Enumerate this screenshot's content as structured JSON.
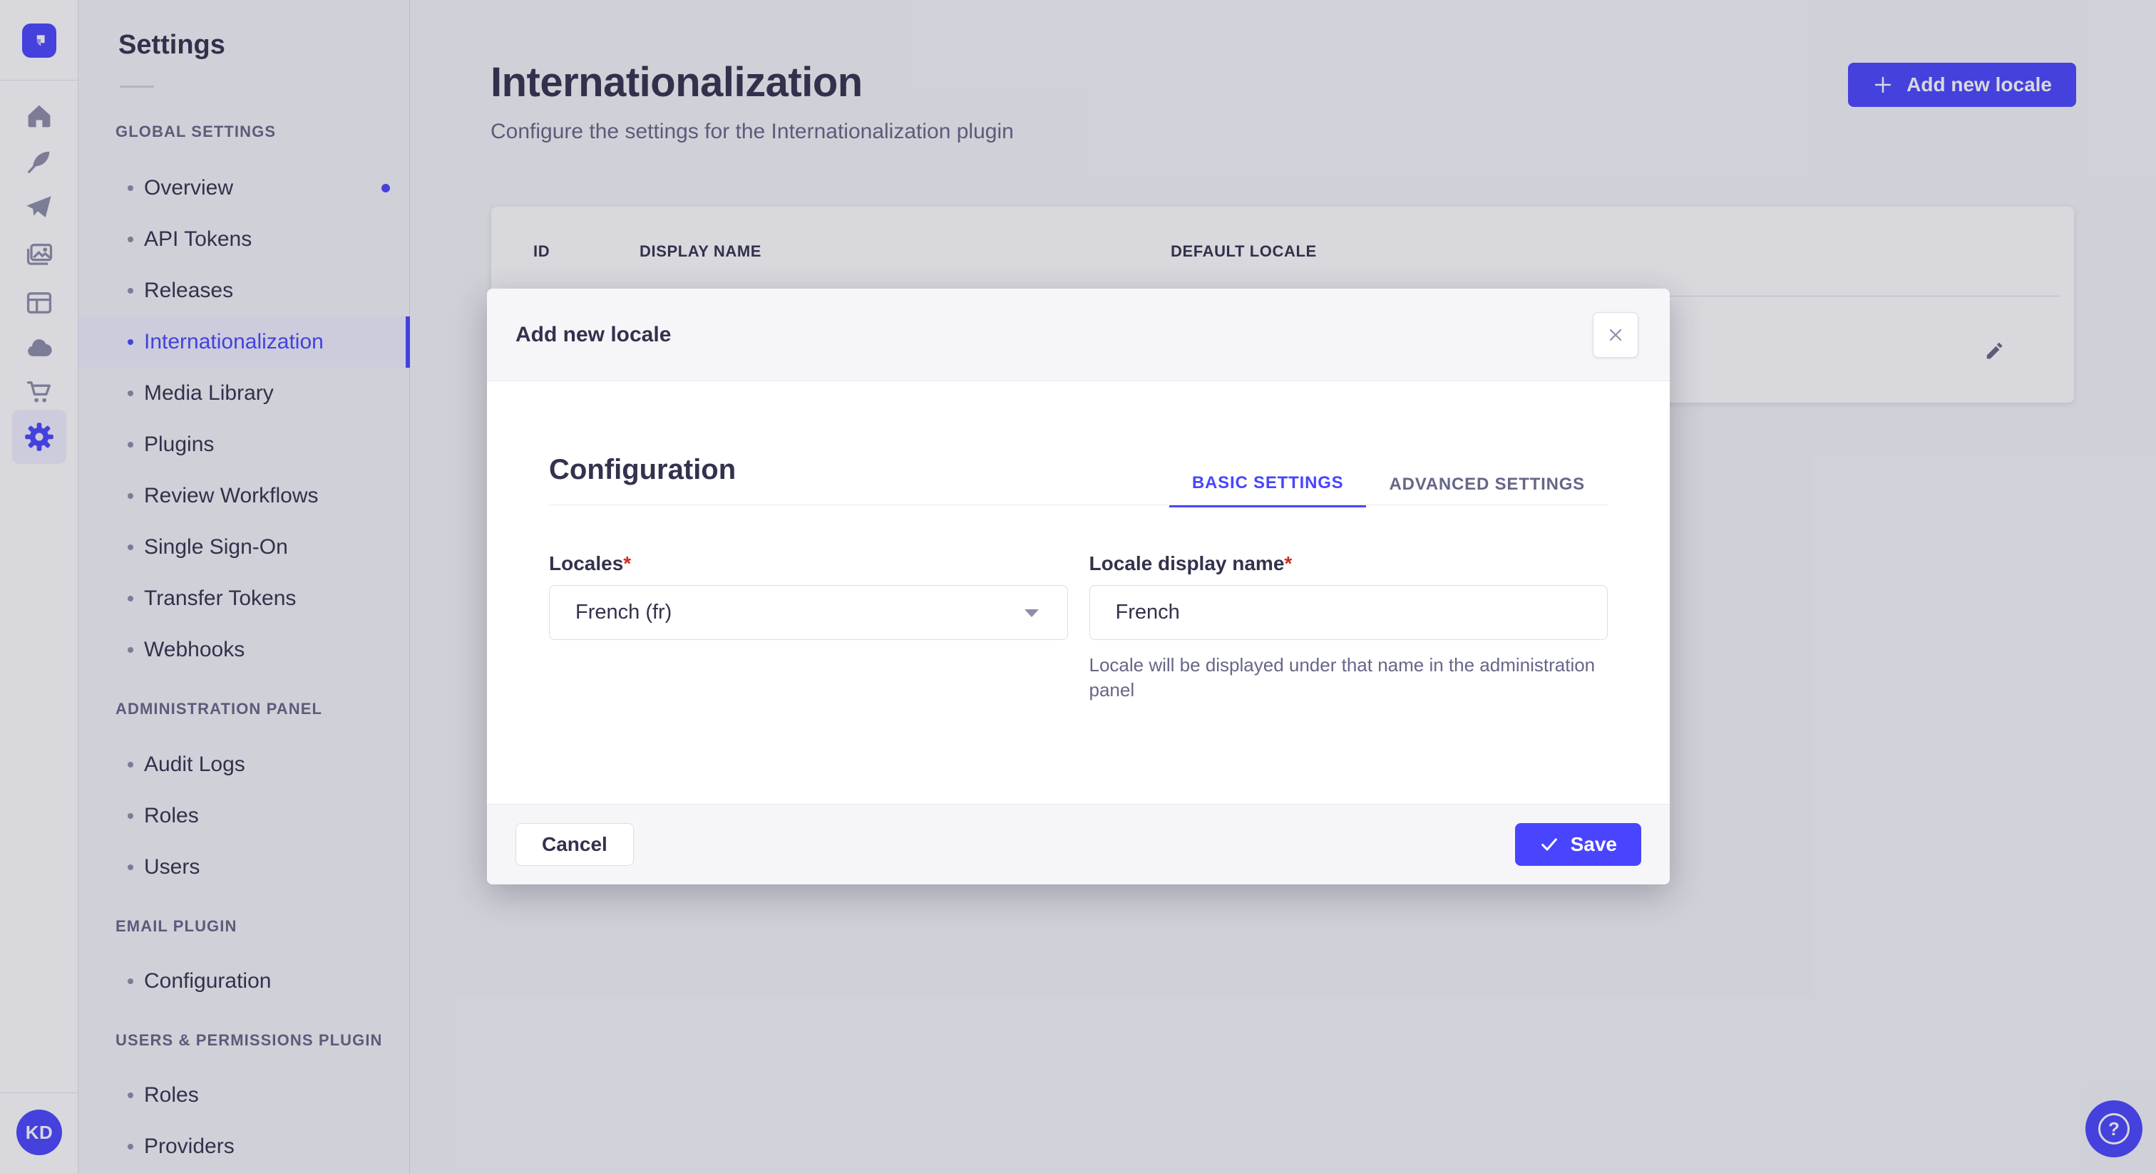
{
  "app": {
    "brand_icon": "strapi-logo",
    "icon_rail_items": [
      "home-icon",
      "feather-icon",
      "paper-plane-icon",
      "media-icon",
      "layout-icon",
      "cloud-icon",
      "cart-icon",
      "gear-icon"
    ],
    "user": {
      "initials": "KD"
    },
    "help_icon": "question-mark-icon"
  },
  "subnav": {
    "title": "Settings",
    "sections": [
      {
        "label": "GLOBAL SETTINGS",
        "items": [
          {
            "label": "Overview",
            "has_notification": true,
            "active": false
          },
          {
            "label": "API Tokens",
            "active": false
          },
          {
            "label": "Releases",
            "active": false
          },
          {
            "label": "Internationalization",
            "active": true
          },
          {
            "label": "Media Library",
            "active": false
          },
          {
            "label": "Plugins",
            "active": false
          },
          {
            "label": "Review Workflows",
            "active": false
          },
          {
            "label": "Single Sign-On",
            "active": false
          },
          {
            "label": "Transfer Tokens",
            "active": false
          },
          {
            "label": "Webhooks",
            "active": false
          }
        ]
      },
      {
        "label": "ADMINISTRATION PANEL",
        "items": [
          {
            "label": "Audit Logs",
            "active": false
          },
          {
            "label": "Roles",
            "active": false
          },
          {
            "label": "Users",
            "active": false
          }
        ]
      },
      {
        "label": "EMAIL PLUGIN",
        "items": [
          {
            "label": "Configuration",
            "active": false
          }
        ]
      },
      {
        "label": "USERS & PERMISSIONS PLUGIN",
        "items": [
          {
            "label": "Roles",
            "active": false
          },
          {
            "label": "Providers",
            "active": false
          }
        ]
      }
    ]
  },
  "page": {
    "title": "Internationalization",
    "subtitle": "Configure the settings for the Internationalization plugin",
    "add_button": "Add new locale"
  },
  "table": {
    "columns": [
      "ID",
      "DISPLAY NAME",
      "DEFAULT LOCALE"
    ],
    "row_action_icon": "pencil-icon"
  },
  "modal": {
    "title": "Add new locale",
    "close_icon": "close-icon",
    "section_title": "Configuration",
    "tabs": [
      {
        "label": "BASIC SETTINGS",
        "active": true
      },
      {
        "label": "ADVANCED SETTINGS",
        "active": false
      }
    ],
    "fields": {
      "locales": {
        "label": "Locales",
        "required": "*",
        "value": "French (fr)"
      },
      "display_name": {
        "label": "Locale display name",
        "required": "*",
        "value": "French",
        "help": "Locale will be displayed under that name in the administration panel"
      }
    },
    "cancel_label": "Cancel",
    "save_label": "Save"
  },
  "colors": {
    "primary": "#4945ff",
    "primary_light": "#f0f0ff",
    "text": "#32324d",
    "text_muted": "#666687",
    "border": "#dcdce4",
    "divider": "#eaeaef",
    "danger": "#d02b20",
    "background": "#f6f6f9"
  }
}
